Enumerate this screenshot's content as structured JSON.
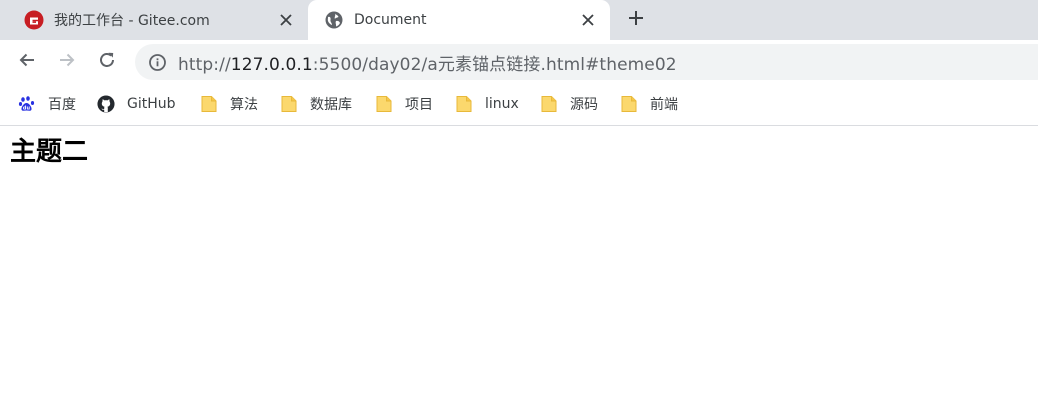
{
  "tabs": [
    {
      "title": "我的工作台 - Gitee.com",
      "favicon": "gitee-logo-icon"
    },
    {
      "title": "Document",
      "favicon": "globe-icon"
    }
  ],
  "toolbar": {
    "url_scheme": "http://",
    "url_host": "127.0.0.1",
    "url_rest": ":5500/day02/a元素锚点链接.html#theme02"
  },
  "bookmarks": [
    {
      "label": "百度",
      "icon": "baidu-paw-icon"
    },
    {
      "label": "GitHub",
      "icon": "github-icon"
    },
    {
      "label": "算法",
      "icon": "folder-icon"
    },
    {
      "label": "数据库",
      "icon": "folder-icon"
    },
    {
      "label": "项目",
      "icon": "folder-icon"
    },
    {
      "label": "linux",
      "icon": "folder-icon"
    },
    {
      "label": "源码",
      "icon": "folder-icon"
    },
    {
      "label": "前端",
      "icon": "folder-icon"
    }
  ],
  "page": {
    "heading": "主题二"
  },
  "colors": {
    "tabstrip_bg": "#dee1e6",
    "omnibox_bg": "#f1f3f4",
    "gitee_red": "#c71d23",
    "baidu_blue": "#2932e1",
    "folder_yellow": "#fbd86d"
  }
}
